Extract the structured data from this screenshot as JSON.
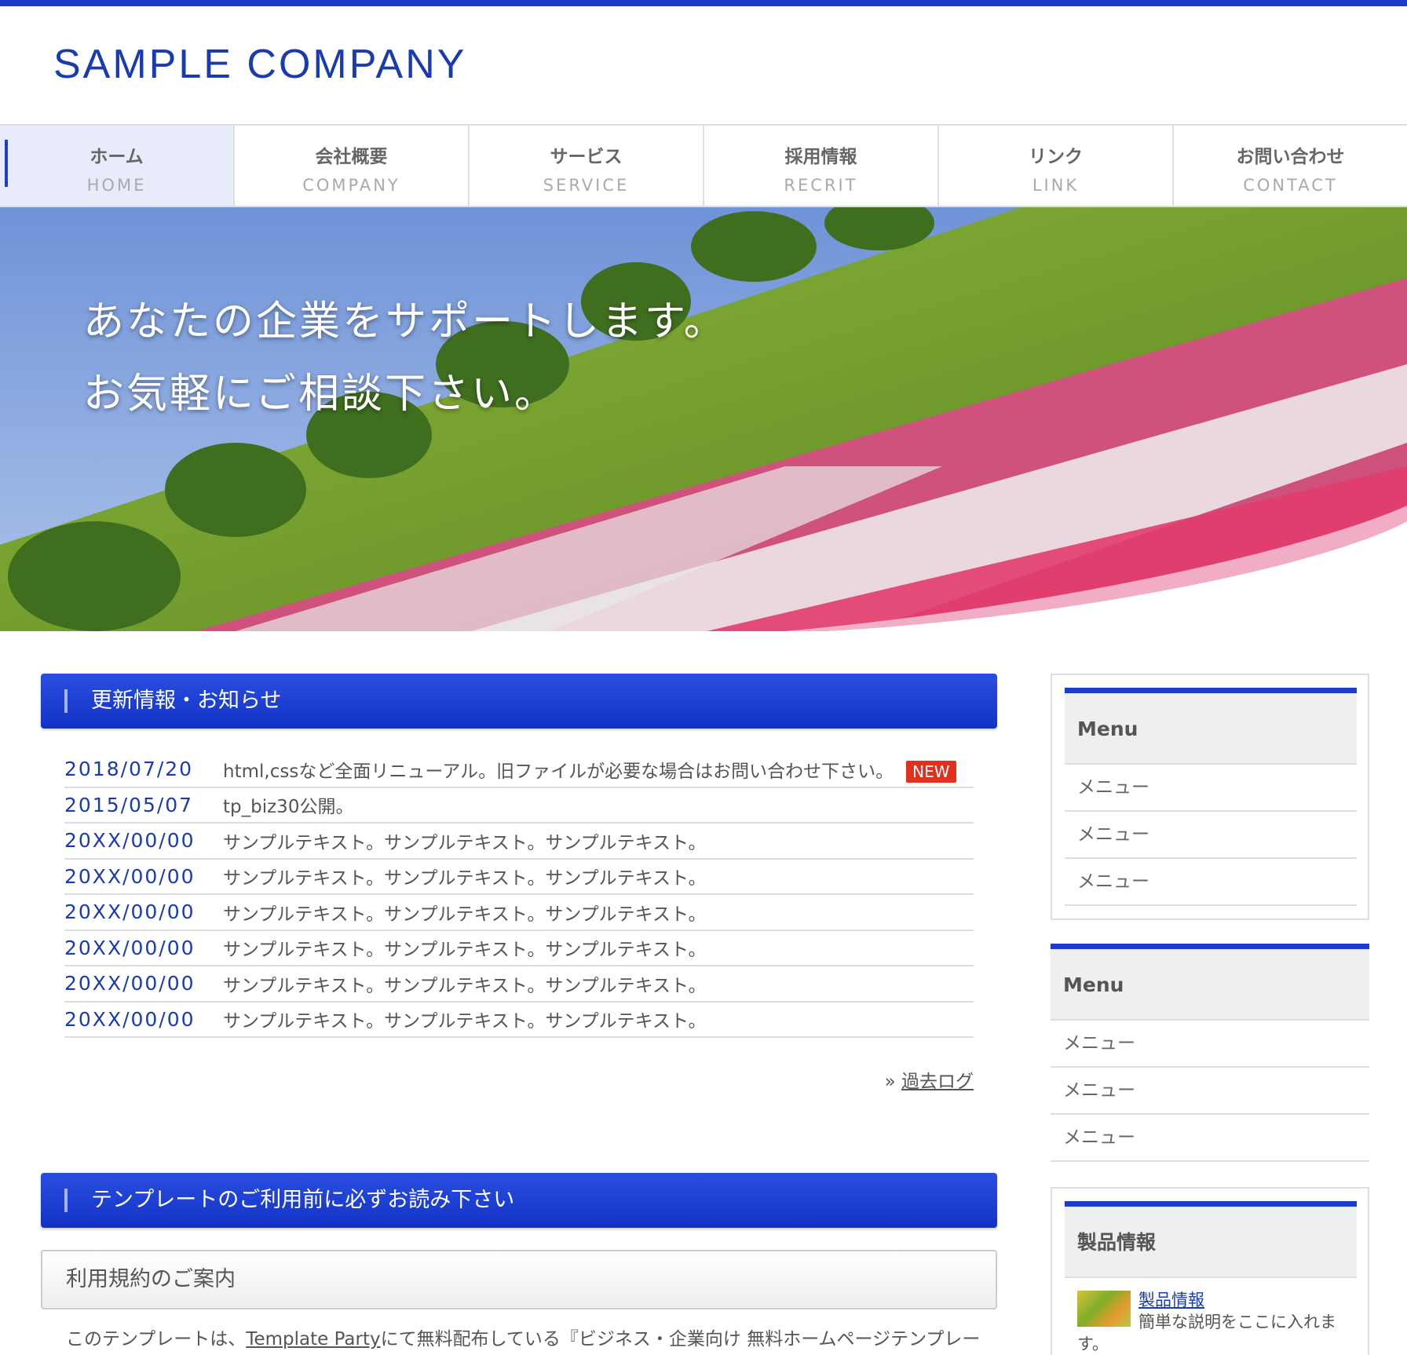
{
  "header": {
    "logo": "SAMPLE COMPANY"
  },
  "nav": [
    {
      "jp": "ホーム",
      "en": "HOME"
    },
    {
      "jp": "会社概要",
      "en": "COMPANY"
    },
    {
      "jp": "サービス",
      "en": "SERVICE"
    },
    {
      "jp": "採用情報",
      "en": "RECRIT"
    },
    {
      "jp": "リンク",
      "en": "LINK"
    },
    {
      "jp": "お問い合わせ",
      "en": "CONTACT"
    }
  ],
  "hero": {
    "line1": "あなたの企業をサポートします。",
    "line2": "お気軽にご相談下さい。"
  },
  "news": {
    "heading": "更新情報・お知らせ",
    "items": [
      {
        "date": "2018/07/20",
        "text": "html,cssなど全面リニューアル。旧ファイルが必要な場合はお問い合わせ下さい。",
        "badge": "NEW"
      },
      {
        "date": "2015/05/07",
        "text": "tp_biz30公開。"
      },
      {
        "date": "20XX/00/00",
        "text": "サンプルテキスト。サンプルテキスト。サンプルテキスト。"
      },
      {
        "date": "20XX/00/00",
        "text": "サンプルテキスト。サンプルテキスト。サンプルテキスト。"
      },
      {
        "date": "20XX/00/00",
        "text": "サンプルテキスト。サンプルテキスト。サンプルテキスト。"
      },
      {
        "date": "20XX/00/00",
        "text": "サンプルテキスト。サンプルテキスト。サンプルテキスト。"
      },
      {
        "date": "20XX/00/00",
        "text": "サンプルテキスト。サンプルテキスト。サンプルテキスト。"
      },
      {
        "date": "20XX/00/00",
        "text": "サンプルテキスト。サンプルテキスト。サンプルテキスト。"
      }
    ],
    "archive_prefix": "»",
    "archive_link": "過去ログ"
  },
  "template_notice": {
    "heading": "テンプレートのご利用前に必ずお読み下さい",
    "subheading": "利用規約のご案内",
    "intro_before": "このテンプレートは、",
    "intro_link": "Template Party",
    "intro_after": "にて無料配布している『ビジネス・企業向け 無料ホームページテンプレー"
  },
  "sidebar": {
    "box1": {
      "title": "Menu",
      "items": [
        "メニュー",
        "メニュー",
        "メニュー"
      ]
    },
    "box2": {
      "title": "Menu",
      "items": [
        "メニュー",
        "メニュー",
        "メニュー"
      ]
    },
    "box3": {
      "title": "製品情報",
      "product_link": "製品情報",
      "product_desc": "簡単な説明をここに入れます。"
    }
  },
  "colors": {
    "accent": "#1d3dc9",
    "date": "#1a3bb0",
    "badge": "#e0301e"
  }
}
